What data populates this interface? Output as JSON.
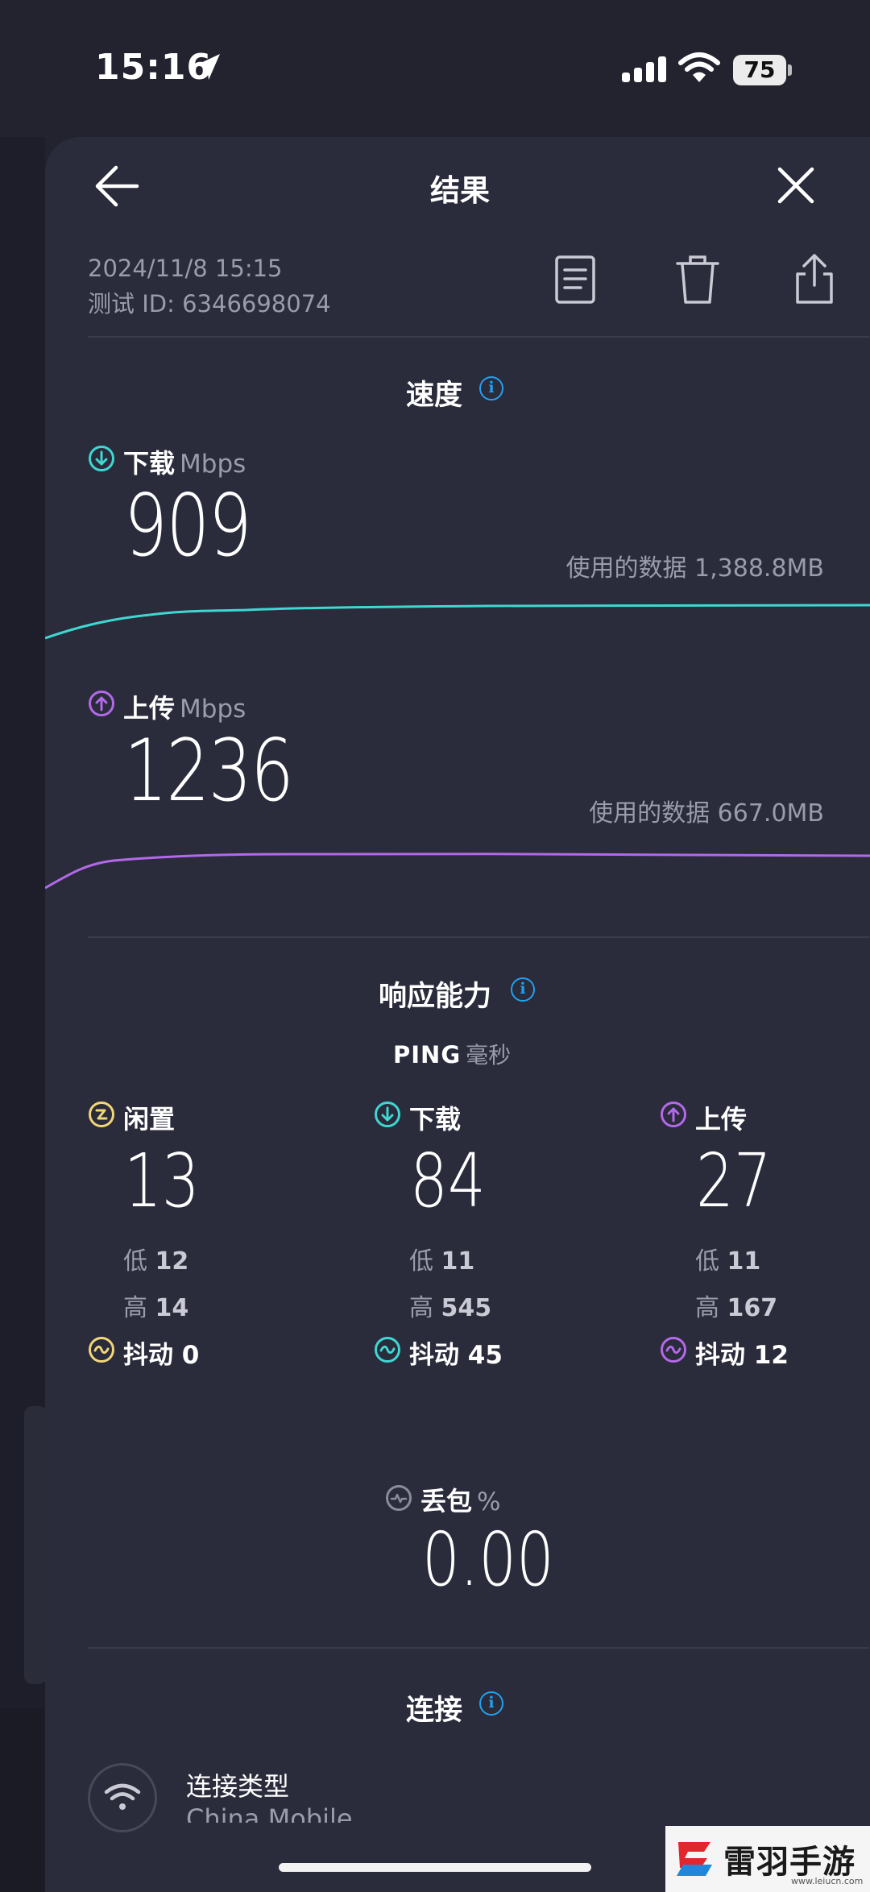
{
  "status_bar": {
    "time": "15:16",
    "battery": "75"
  },
  "nav": {
    "title": "结果"
  },
  "meta": {
    "datetime": "2024/11/8 15:15",
    "test_id": "测试 ID: 6346698074"
  },
  "speed": {
    "title": "速度",
    "download": {
      "label": "下载",
      "unit": "Mbps",
      "value": "909",
      "data_used": "使用的数据 1,388.8MB",
      "color": "#3fd7d2"
    },
    "upload": {
      "label": "上传",
      "unit": "Mbps",
      "value": "1236",
      "data_used": "使用的数据 667.0MB",
      "color": "#b369e8"
    }
  },
  "responsiveness": {
    "title": "响应能力",
    "ping_label": "PING",
    "ping_unit": "毫秒",
    "low_label": "低",
    "high_label": "高",
    "jitter_label": "抖动",
    "columns": [
      {
        "title": "闲置",
        "value": "13",
        "low": "12",
        "high": "14",
        "jitter": "0",
        "color": "#f2d67a",
        "icon": "idle-icon"
      },
      {
        "title": "下载",
        "value": "84",
        "low": "11",
        "high": "545",
        "jitter": "45",
        "color": "#3fd7d2",
        "icon": "download-icon"
      },
      {
        "title": "上传",
        "value": "27",
        "low": "11",
        "high": "167",
        "jitter": "12",
        "color": "#b369e8",
        "icon": "upload-icon"
      }
    ]
  },
  "packet_loss": {
    "label": "丢包",
    "unit": "%",
    "value": "0.00"
  },
  "connection": {
    "title": "连接",
    "type_label": "连接类型",
    "type_value": "China Mobile"
  },
  "watermark": {
    "text": "雷羽手游网",
    "sub": "www.leiucn.com"
  },
  "colors": {
    "background": "#22232f",
    "sheet": "#2a2b3b",
    "accent_info": "#21a1f1",
    "muted_text": "#9a9caa"
  }
}
